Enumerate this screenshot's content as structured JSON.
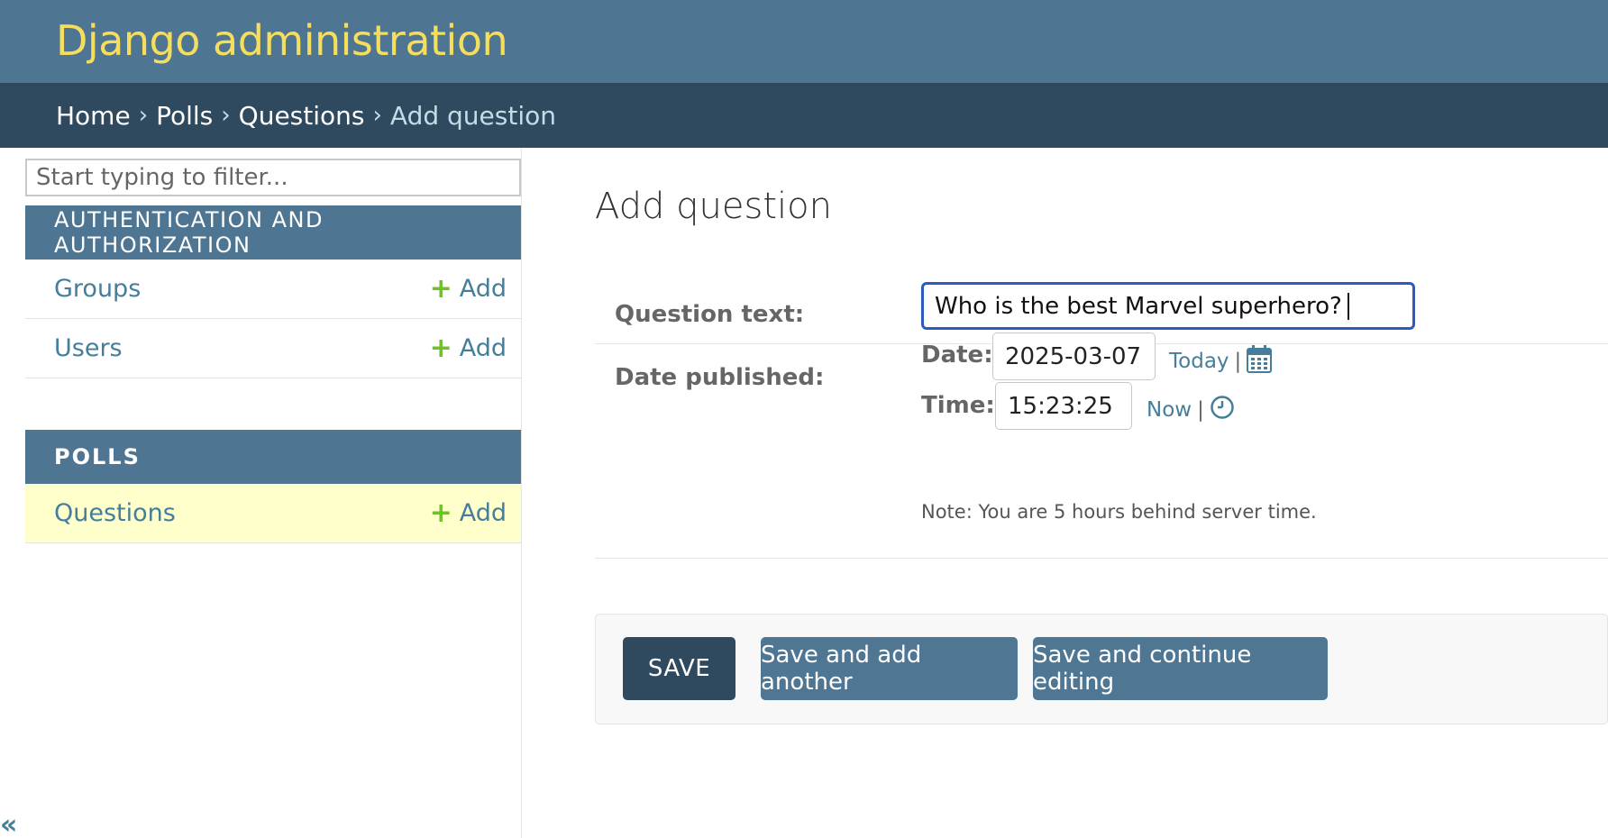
{
  "header": {
    "site_name": "Django administration",
    "brand_color": "#f5dd5d",
    "bg_color": "#4e7591"
  },
  "breadcrumbs": {
    "items": [
      "Home",
      "Polls",
      "Questions"
    ],
    "separator": "›",
    "current": "Add question"
  },
  "sidebar": {
    "filter_placeholder": "Start typing to filter...",
    "modules": [
      {
        "caption": "AUTHENTICATION AND AUTHORIZATION",
        "models": [
          {
            "name": "Groups",
            "add": "Add"
          },
          {
            "name": "Users",
            "add": "Add"
          }
        ]
      },
      {
        "caption": "POLLS",
        "models": [
          {
            "name": "Questions",
            "add": "Add",
            "active": true
          }
        ]
      }
    ],
    "collapse_icon": "«"
  },
  "content": {
    "title": "Add question",
    "question_text": {
      "label": "Question text:",
      "value": "Who is the best Marvel superhero?"
    },
    "date_published": {
      "label": "Date published:",
      "date_label": "Date:",
      "date_value": "2025-03-07",
      "today": "Today",
      "time_label": "Time:",
      "time_value": "15:23:25",
      "now": "Now",
      "pipe": "|",
      "note": "Note: You are 5 hours behind server time."
    },
    "buttons": {
      "save": "SAVE",
      "save_add": "Save and add another",
      "save_continue": "Save and continue editing"
    }
  },
  "icons": {
    "calendar": "calendar-icon",
    "clock": "clock-icon",
    "add": "plus-icon"
  }
}
